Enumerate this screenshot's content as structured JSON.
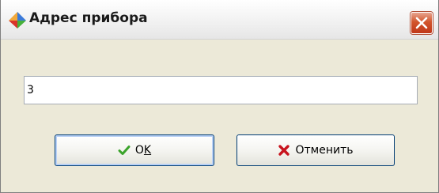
{
  "window": {
    "title": "Адрес прибора",
    "icon": "app-icon",
    "close_icon": "close-icon"
  },
  "address_field": {
    "value": "3"
  },
  "buttons": {
    "ok_label_main": "O",
    "ok_label_underlined": "K",
    "ok_icon": "checkmark-icon",
    "cancel_label": "Отменить",
    "cancel_icon": "cross-icon"
  },
  "colors": {
    "dialog_background": "#ece9d8",
    "close_button": "#d2552c",
    "checkmark": "#3aa32a",
    "cross": "#c8141e",
    "focus_ring": "#b9d1f5"
  }
}
